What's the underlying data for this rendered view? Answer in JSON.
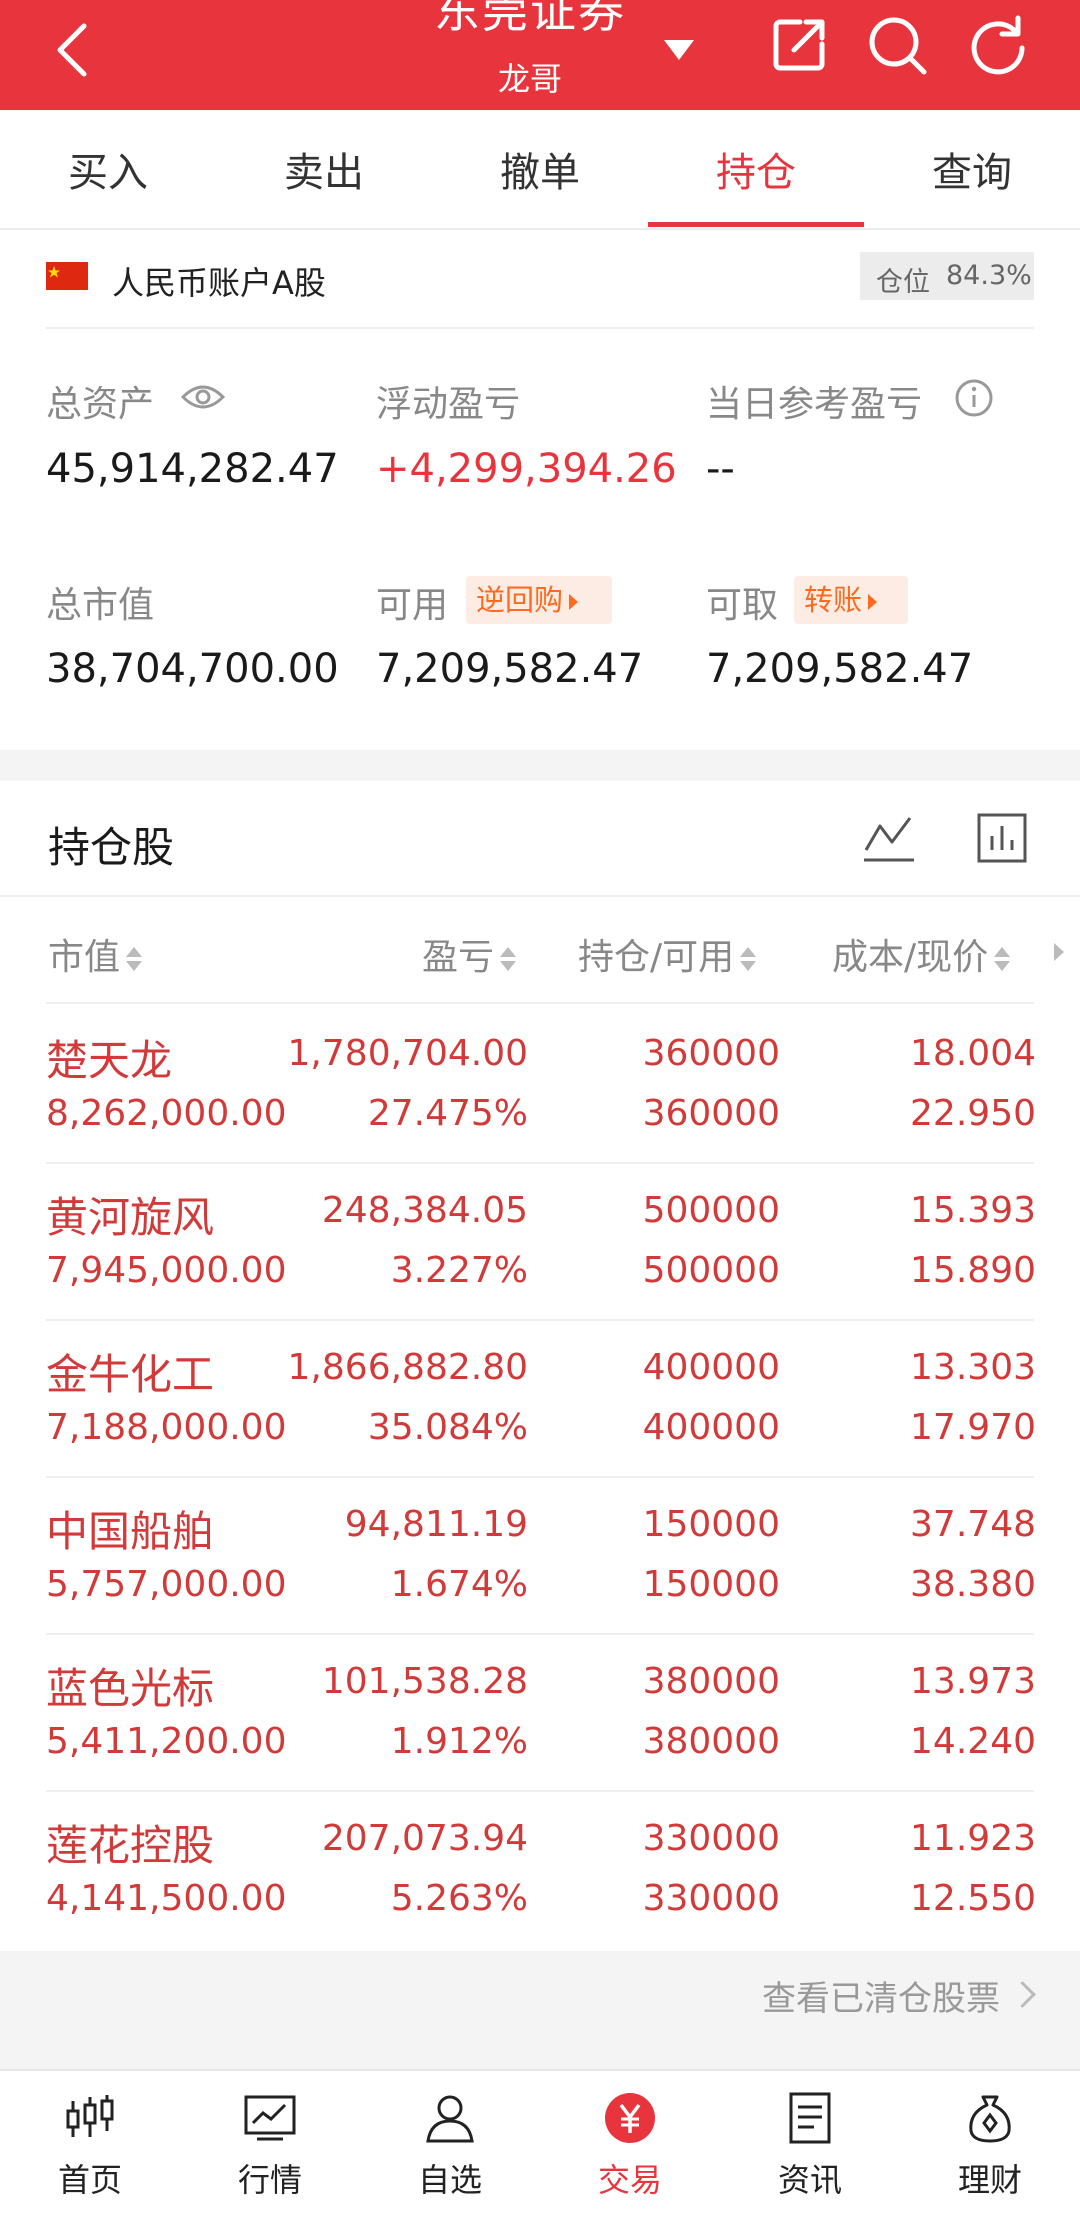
{
  "header": {
    "title": "东莞证券",
    "subtitle": "龙哥",
    "bg_color": "#e8353d",
    "icons": [
      "back-icon",
      "dropdown-caret-icon",
      "share-icon",
      "search-icon",
      "refresh-icon"
    ]
  },
  "tabs": [
    {
      "label": "买入",
      "active": false
    },
    {
      "label": "卖出",
      "active": false
    },
    {
      "label": "撤单",
      "active": false
    },
    {
      "label": "持仓",
      "active": true
    },
    {
      "label": "查询",
      "active": false
    }
  ],
  "account": {
    "title": "人民币账户A股",
    "position_label": "仓位",
    "position_value": "84.3%",
    "total_assets_label": "总资产",
    "total_assets": "45,914,282.47",
    "floating_pl_label": "浮动盈亏",
    "floating_pl": "+4,299,394.26",
    "daily_pl_label": "当日参考盈亏",
    "daily_pl": "--",
    "market_value_label": "总市值",
    "market_value": "38,704,700.00",
    "available_label": "可用",
    "available_tag": "逆回购",
    "available": "7,209,582.47",
    "withdrawable_label": "可取",
    "withdrawable_tag": "转账",
    "withdrawable": "7,209,582.47"
  },
  "holdings": {
    "title": "持仓股",
    "columns": [
      "市值",
      "盈亏",
      "持仓/可用",
      "成本/现价"
    ],
    "rows": [
      {
        "name": "楚天龙",
        "market_value": "8,262,000.00",
        "pl": "1,780,704.00",
        "pl_pct": "27.475%",
        "position": "360000",
        "available": "360000",
        "cost": "18.004",
        "price": "22.950"
      },
      {
        "name": "黄河旋风",
        "market_value": "7,945,000.00",
        "pl": "248,384.05",
        "pl_pct": "3.227%",
        "position": "500000",
        "available": "500000",
        "cost": "15.393",
        "price": "15.890"
      },
      {
        "name": "金牛化工",
        "market_value": "7,188,000.00",
        "pl": "1,866,882.80",
        "pl_pct": "35.084%",
        "position": "400000",
        "available": "400000",
        "cost": "13.303",
        "price": "17.970"
      },
      {
        "name": "中国船舶",
        "market_value": "5,757,000.00",
        "pl": "94,811.19",
        "pl_pct": "1.674%",
        "position": "150000",
        "available": "150000",
        "cost": "37.748",
        "price": "38.380"
      },
      {
        "name": "蓝色光标",
        "market_value": "5,411,200.00",
        "pl": "101,538.28",
        "pl_pct": "1.912%",
        "position": "380000",
        "available": "380000",
        "cost": "13.973",
        "price": "14.240"
      },
      {
        "name": "莲花控股",
        "market_value": "4,141,500.00",
        "pl": "207,073.94",
        "pl_pct": "5.263%",
        "position": "330000",
        "available": "330000",
        "cost": "11.923",
        "price": "12.550"
      }
    ],
    "cleared_link": "查看已清仓股票"
  },
  "bottom_nav": [
    {
      "label": "首页",
      "icon": "candlestick-icon",
      "active": false
    },
    {
      "label": "行情",
      "icon": "chart-line-icon",
      "active": false
    },
    {
      "label": "自选",
      "icon": "user-icon",
      "active": false
    },
    {
      "label": "交易",
      "icon": "yuan-icon",
      "active": true
    },
    {
      "label": "资讯",
      "icon": "document-icon",
      "active": false
    },
    {
      "label": "理财",
      "icon": "money-bag-icon",
      "active": false
    }
  ]
}
